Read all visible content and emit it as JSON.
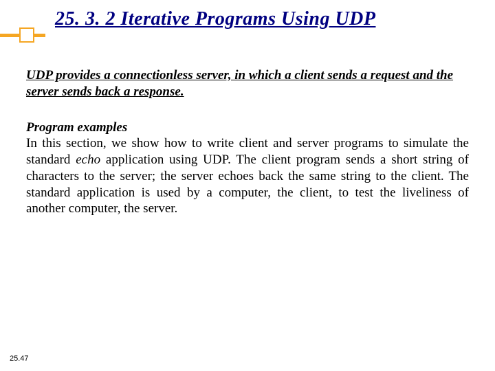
{
  "title": "25. 3. 2  Iterative Programs Using UDP",
  "intro": "UDP provides a connectionless server, in which a client sends a request and the server sends back a response.",
  "subhead": "Program examples",
  "body_before_echo": "In this section, we show how to write client and server programs to simulate the standard ",
  "body_echo": "echo",
  "body_after_echo": " application using UDP. The client program sends a short string of characters to the server; the server echoes back the same string to the client. The standard application is used by a computer, the client, to test the liveliness of another computer, the server.",
  "slide_number": "25.47"
}
